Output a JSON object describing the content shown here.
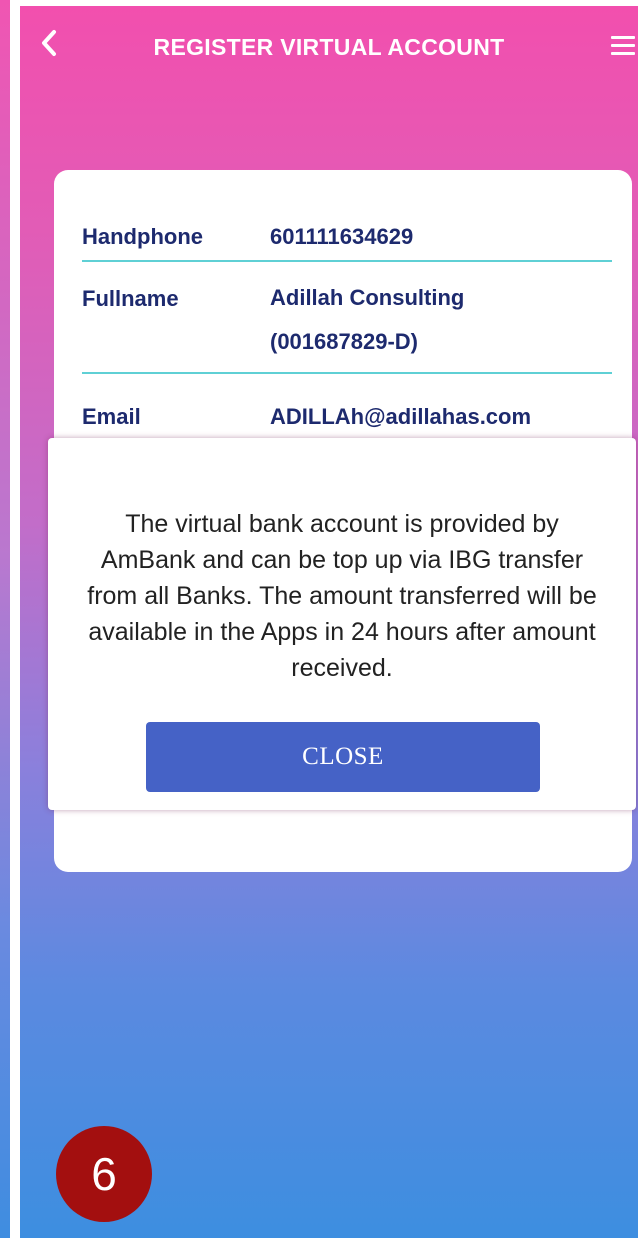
{
  "header": {
    "title": "REGISTER VIRTUAL ACCOUNT",
    "back_icon": "chevron-left-icon",
    "menu_icon": "hamburger-menu-icon"
  },
  "details": {
    "handphone_label": "Handphone",
    "handphone_value": "601111634629",
    "fullname_label": "Fullname",
    "fullname_line1": "Adillah Consulting",
    "fullname_line2": "(001687829-D)",
    "email_label": "Email",
    "email_value": "ADILLAh@adillahas.com"
  },
  "dialog": {
    "message_lines": [
      "The virtual bank account is provided by",
      "AmBank and can be top up via IBG transfer",
      "from all Banks. The amount transferred will be",
      "available in the Apps in 24 hours after amount",
      "received."
    ],
    "close_label": "CLOSE"
  },
  "step_badge": "6",
  "colors": {
    "gradient_top": "#f24fae",
    "gradient_bottom": "#3d8ee0",
    "text_navy": "#1d2a6e",
    "divider": "#5fd0d5",
    "button": "#4562c6",
    "badge": "#a30f0f"
  }
}
